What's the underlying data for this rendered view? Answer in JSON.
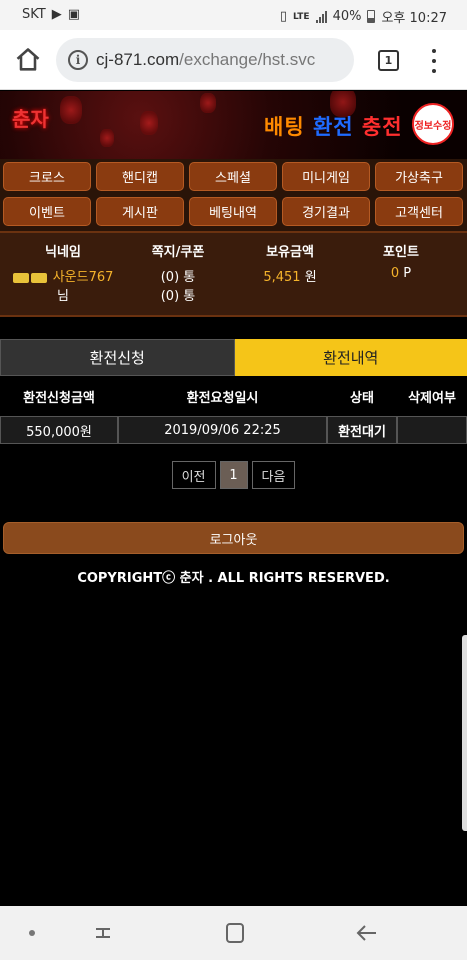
{
  "status_bar": {
    "carrier": "SKT",
    "network": "LTE",
    "battery": "40%",
    "time": "오후 10:27"
  },
  "browser": {
    "url_host": "cj-871.com",
    "url_path": "/exchange/hst.svc",
    "tab_count": "1"
  },
  "banner": {
    "logo": "춘자",
    "title_part1": "배팅",
    "title_part2": "환전",
    "title_part3": "충전",
    "badge": "정보수정"
  },
  "menu": [
    {
      "label": "크로스"
    },
    {
      "label": "핸디캡"
    },
    {
      "label": "스페셜"
    },
    {
      "label": "미니게임"
    },
    {
      "label": "가상축구"
    },
    {
      "label": "이벤트"
    },
    {
      "label": "게시판"
    },
    {
      "label": "베팅내역"
    },
    {
      "label": "경기결과"
    },
    {
      "label": "고객센터"
    }
  ],
  "user": {
    "nickname_label": "닉네임",
    "nickname": "사운드767",
    "nickname_suffix": "님",
    "message_label": "쪽지/쿠폰",
    "messages": "(0) 통",
    "coupons": "(0) 통",
    "balance_label": "보유금액",
    "balance": "5,451",
    "balance_unit": "원",
    "points_label": "포인트",
    "points": "0",
    "points_unit": "P"
  },
  "tabs": {
    "apply": "환전신청",
    "history": "환전내역"
  },
  "table": {
    "headers": [
      "환전신청금액",
      "환전요청일시",
      "상태",
      "삭제여부"
    ],
    "rows": [
      {
        "amount": "550,000원",
        "datetime": "2019/09/06 22:25",
        "status": "환전대기",
        "delete": ""
      }
    ]
  },
  "pagination": {
    "prev": "이전",
    "current": "1",
    "next": "다음"
  },
  "logout_label": "로그아웃",
  "copyright": "COPYRIGHTⓒ 춘자 . ALL RIGHTS RESERVED."
}
